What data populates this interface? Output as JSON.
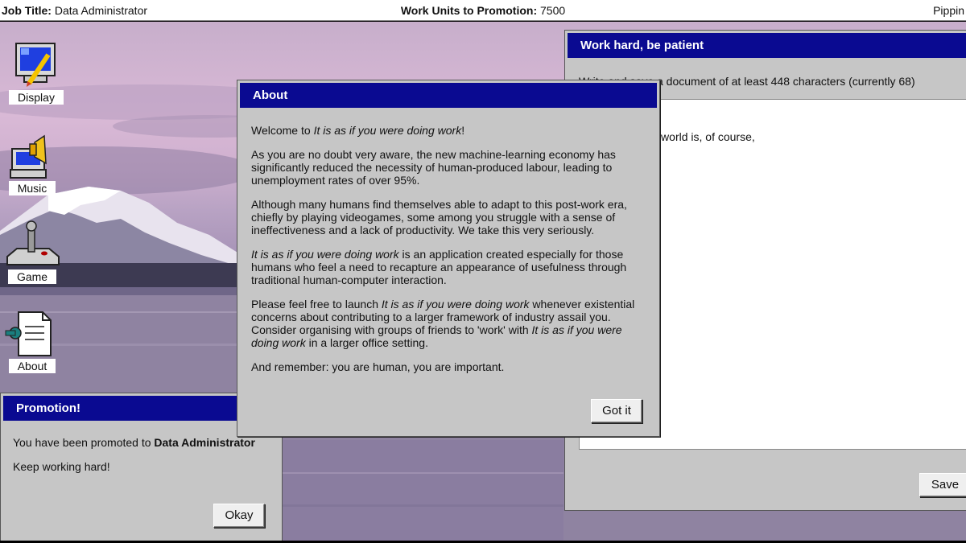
{
  "topbar": {
    "job_title_label": "Job Title:",
    "job_title_value": "Data Administrator",
    "promotion_label": "Work Units to Promotion:",
    "promotion_value": "7500",
    "username": "Pippin"
  },
  "desktop_icons": [
    {
      "label": "Display",
      "icon": "display-icon"
    },
    {
      "label": "Music",
      "icon": "music-icon"
    },
    {
      "label": "Game",
      "icon": "joystick-icon"
    },
    {
      "label": "About",
      "icon": "document-icon"
    }
  ],
  "promotion_window": {
    "title": "Promotion!",
    "line1_prefix": "You have been promoted to",
    "line1_role": "Data Administrator",
    "line2": "Keep working hard!",
    "ok_label": "Okay"
  },
  "work_window": {
    "title": "Work hard, be patient",
    "hint": "Write and save a document of at least 448 characters (currently 68)",
    "document_text": "ells:\n\nful thing in the world is, of course,",
    "save_label": "Save"
  },
  "about_window": {
    "title": "About",
    "app_name": "It is as if you were doing work",
    "p1_prefix": "Welcome to",
    "p1_suffix": "!",
    "p2": "As you are no doubt very aware, the new machine-learning economy has significantly reduced the necessity of human-produced labour, leading to unemployment rates of over 95%.",
    "p3": "Although many humans find themselves able to adapt to this post-work era, chiefly by playing videogames, some among you struggle with a sense of ineffectiveness and a lack of productivity. We take this very seriously.",
    "p4_suffix": "is an application created especially for those humans who feel a need to recapture an appearance of usefulness through traditional human-computer interaction.",
    "p5_prefix": "Please feel free to launch",
    "p5_mid": "whenever existential concerns about contributing to a larger framework of industry assail you. Consider organising with groups of friends to 'work' with",
    "p5_suffix": "in a larger office setting.",
    "p6": "And remember: you are human, you are important.",
    "button_label": "Got it"
  },
  "colors": {
    "titlebar": "#0a0a91",
    "window_bg": "#c6c6c6"
  }
}
